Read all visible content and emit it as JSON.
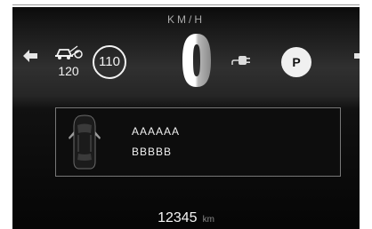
{
  "cluster": {
    "speed_unit": "KM/H",
    "traffic_sign_speed": "120",
    "speed_limit": "110",
    "gear": "P",
    "icons": [
      "arrow-left-icon",
      "traffic-sign-recognition-icon",
      "speed-digit-zero-icon",
      "ev-plug-icon",
      "arrow-right-icon",
      "car-top-view-icon"
    ]
  },
  "message": {
    "line1": "AAAAAA",
    "line2": "BBBBB"
  },
  "odometer": {
    "value": "12345",
    "unit": "km"
  },
  "colors": {
    "text": "#f2f2f2",
    "muted": "#a9a9a9",
    "background": "#0b0b0b"
  }
}
